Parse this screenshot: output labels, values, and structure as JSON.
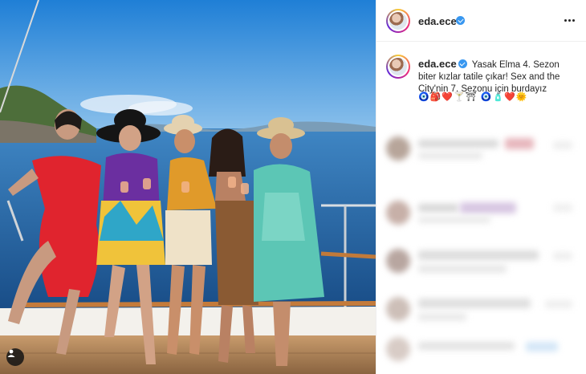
{
  "post": {
    "username": "eda.ece",
    "verified": true,
    "caption_text": "Yasak Elma 4. Sezon biter kızlar tatile çıkar! Sex and the City'nin 7. Sezonu için burdayız",
    "caption_emojis": "🧿🎒❤️🍸⛩ 🧿🧴❤️🌞",
    "more_icon": "more-horizontal-icon",
    "tag_icon": "user-tag-icon"
  },
  "colors": {
    "verified_badge": "#3897f0",
    "ring_gradient": [
      "#f9ce34",
      "#ee2a7b",
      "#6228d7"
    ],
    "divider": "#efefef"
  }
}
